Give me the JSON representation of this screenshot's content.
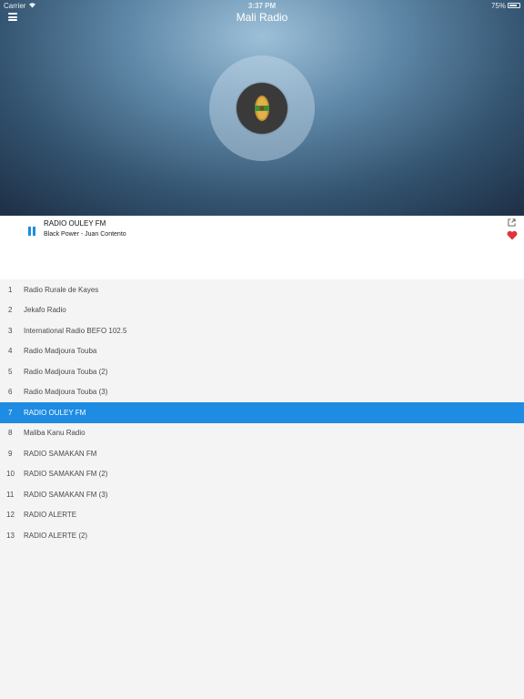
{
  "status_bar": {
    "carrier": "Carrier",
    "time": "3:37 PM",
    "battery": "75%"
  },
  "header": {
    "title": "Mali Radio"
  },
  "now_playing": {
    "station": "RADIO OULEY FM",
    "track": "Black Power - Juan Contento"
  },
  "colors": {
    "accent": "#1e8ce3",
    "favorite": "#e0333d"
  },
  "stations": [
    {
      "num": "1",
      "name": "Radio Rurale de Kayes"
    },
    {
      "num": "2",
      "name": "Jekafo Radio"
    },
    {
      "num": "3",
      "name": "International Radio BEFO 102.5"
    },
    {
      "num": "4",
      "name": "Radio Madjoura Touba"
    },
    {
      "num": "5",
      "name": "Radio Madjoura Touba (2)"
    },
    {
      "num": "6",
      "name": "Radio Madjoura Touba (3)"
    },
    {
      "num": "7",
      "name": "RADIO OULEY FM",
      "active": true
    },
    {
      "num": "8",
      "name": "Maliba Kanu Radio"
    },
    {
      "num": "9",
      "name": "RADIO SAMAKAN FM"
    },
    {
      "num": "10",
      "name": "RADIO SAMAKAN FM (2)"
    },
    {
      "num": "11",
      "name": "RADIO SAMAKAN FM (3)"
    },
    {
      "num": "12",
      "name": "RADIO ALERTE"
    },
    {
      "num": "13",
      "name": "RADIO ALERTE (2)"
    }
  ]
}
